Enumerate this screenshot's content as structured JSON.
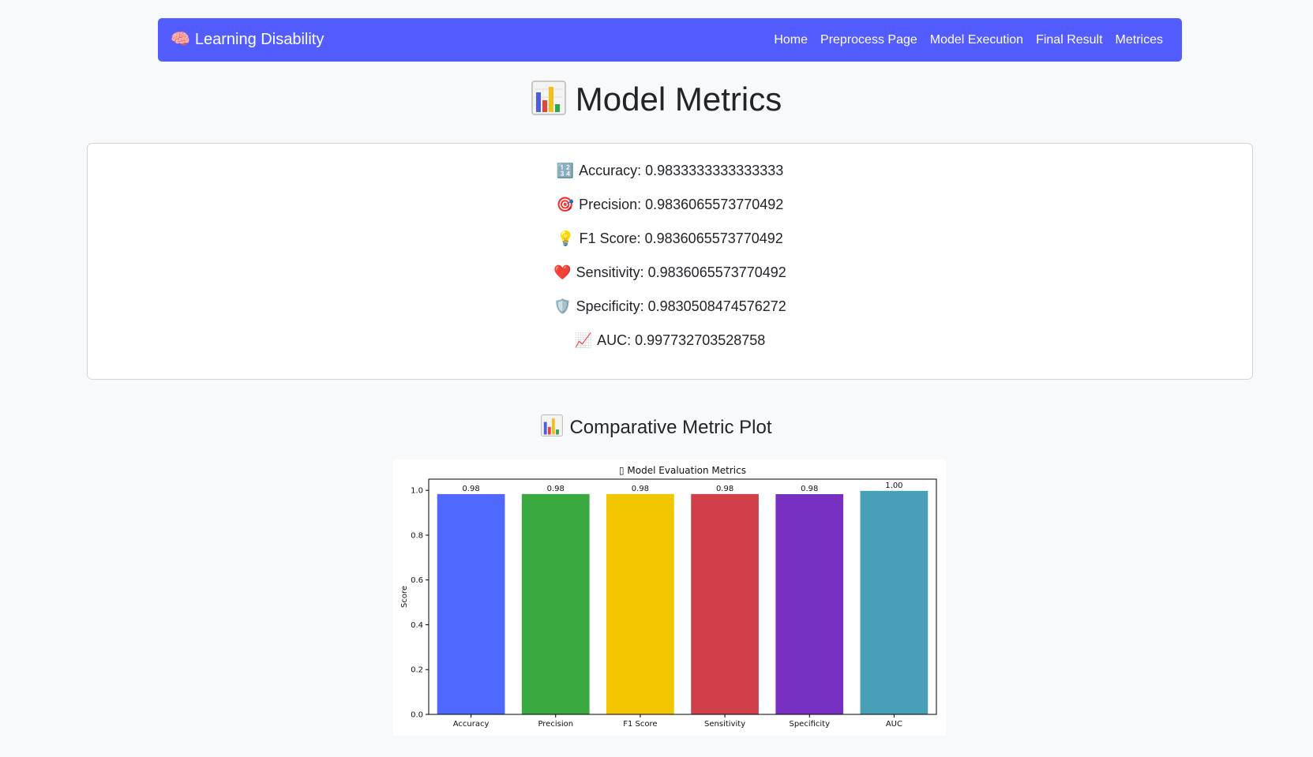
{
  "navbar": {
    "brand_emoji": "🧠",
    "brand": "Learning Disability",
    "links": [
      "Home",
      "Preprocess Page",
      "Model Execution",
      "Final Result",
      "Metrices"
    ]
  },
  "page": {
    "title": "Model Metrics",
    "plot_heading": "Comparative Metric Plot"
  },
  "metrics": [
    {
      "emoji": "🔢",
      "text": "Accuracy: 0.9833333333333333"
    },
    {
      "emoji": "🎯",
      "text": "Precision: 0.9836065573770492"
    },
    {
      "emoji": "💡",
      "text": "F1 Score: 0.9836065573770492"
    },
    {
      "emoji": "❤️",
      "text": "Sensitivity: 0.9836065573770492"
    },
    {
      "emoji": "🛡️",
      "text": "Specificity: 0.9830508474576272"
    },
    {
      "emoji": "📈",
      "text": "AUC: 0.997732703528758"
    }
  ],
  "chart_data": {
    "type": "bar",
    "title": "▯ Model Evaluation Metrics",
    "xlabel": "",
    "ylabel": "Score",
    "ylim": [
      0,
      1.05
    ],
    "yticks": [
      "0.0",
      "0.2",
      "0.4",
      "0.6",
      "0.8",
      "1.0"
    ],
    "categories": [
      "Accuracy",
      "Precision",
      "F1 Score",
      "Sensitivity",
      "Specificity",
      "AUC"
    ],
    "values": [
      0.9833333333333333,
      0.9836065573770492,
      0.9836065573770492,
      0.9836065573770492,
      0.9830508474576272,
      0.997732703528758
    ],
    "data_labels": [
      "0.98",
      "0.98",
      "0.98",
      "0.98",
      "0.98",
      "1.00"
    ],
    "colors": [
      "#4f68ff",
      "#3aa93f",
      "#f2c600",
      "#d0404a",
      "#7730c2",
      "#47a0b8"
    ],
    "grid": false,
    "legend": "none"
  }
}
